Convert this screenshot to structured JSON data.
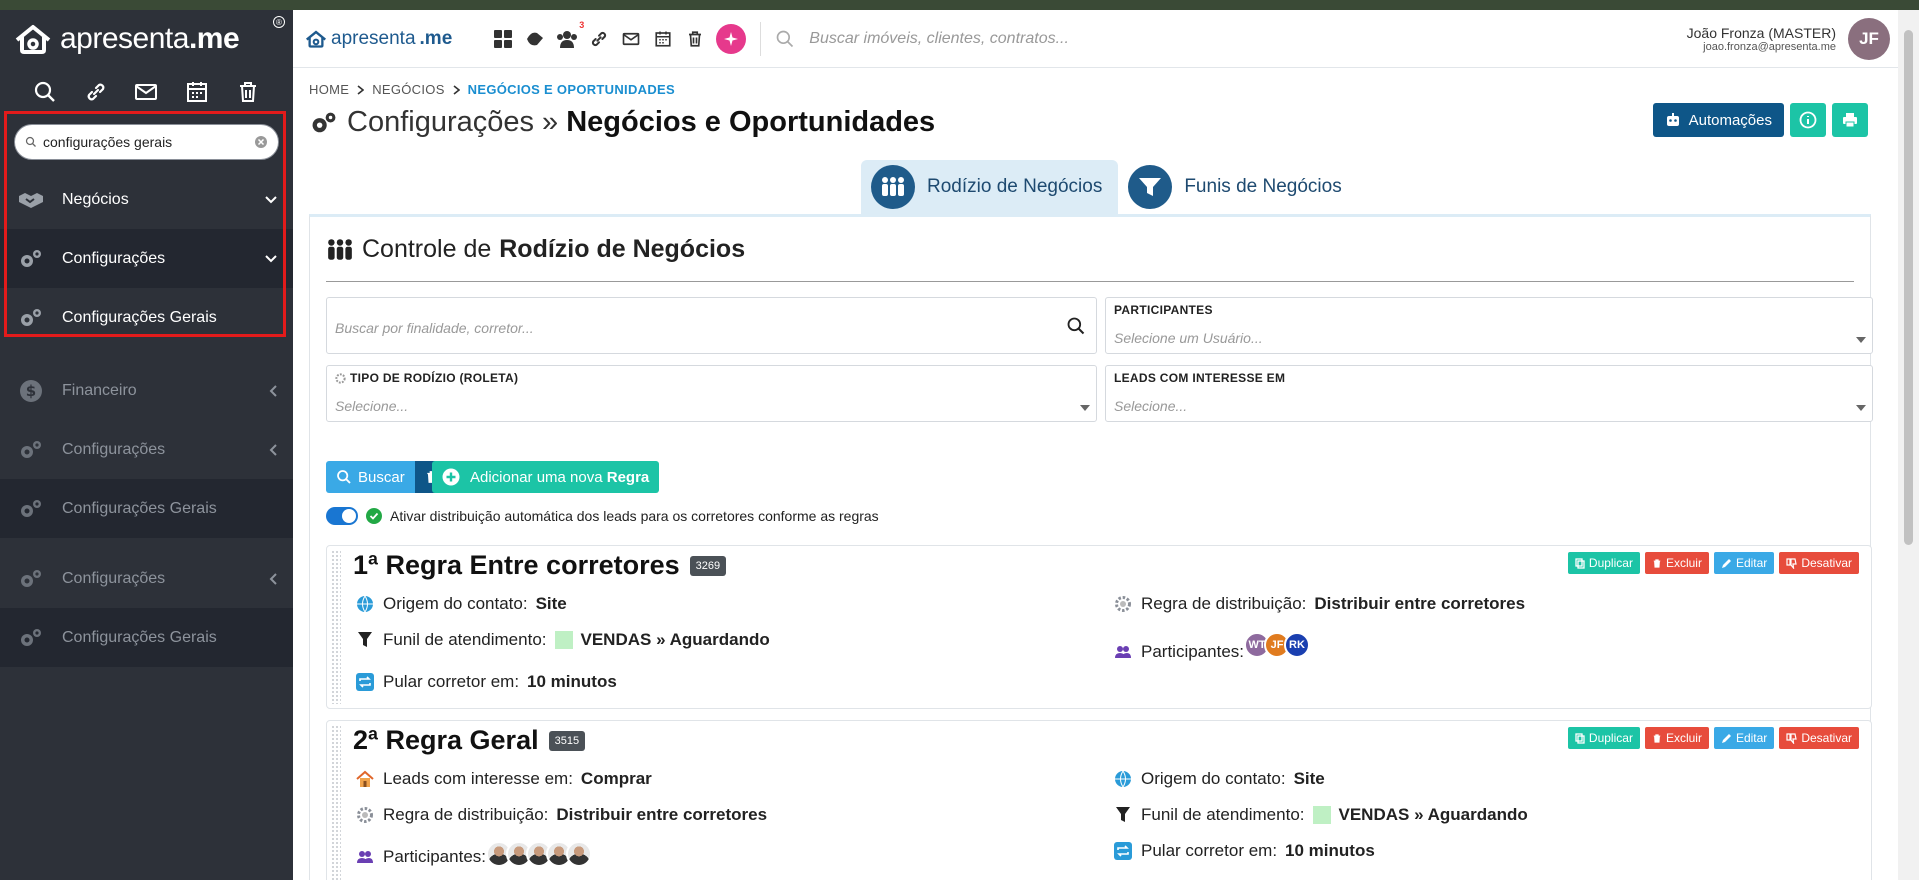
{
  "sidebar": {
    "brand_light": "apresenta",
    "brand_bold": ".me",
    "search_value": "configurações gerais",
    "items": [
      {
        "label": "Negócios",
        "icon": "handshake-icon"
      },
      {
        "label": "Configurações",
        "icon": "gears-icon"
      },
      {
        "label": "Configurações Gerais",
        "icon": "gears-icon"
      },
      {
        "label": "Financeiro",
        "icon": "dollar-icon"
      },
      {
        "label": "Configurações",
        "icon": "gears-icon"
      },
      {
        "label": "Configurações Gerais",
        "icon": "gears-icon"
      },
      {
        "label": "Configurações",
        "icon": "gears-icon"
      },
      {
        "label": "Configurações Gerais",
        "icon": "gears-icon"
      }
    ]
  },
  "header": {
    "brand_light": "apresenta",
    "brand_bold": ".me",
    "notification_count": "3",
    "search_placeholder": "Buscar imóveis, clientes, contratos...",
    "user_name": "João Fronza (MASTER)",
    "user_email": "joao.fronza@apresenta.me",
    "user_initials": "JF"
  },
  "breadcrumb": {
    "home": "HOME",
    "section": "NEGÓCIOS",
    "current": "NEGÓCIOS E OPORTUNIDADES"
  },
  "page": {
    "title_light": "Configurações »",
    "title_bold": "Negócios e Oportunidades",
    "automations_label": "Automações"
  },
  "tabs": [
    {
      "label": "Rodízio de Negócios"
    },
    {
      "label": "Funis de Negócios"
    }
  ],
  "panel": {
    "title_light": "Controle de",
    "title_bold": "Rodízio de Negócios",
    "search_placeholder": "Buscar por finalidade, corretor...",
    "participants_label": "PARTICIPANTES",
    "participants_placeholder": "Selecione um Usuário...",
    "type_label": "TIPO DE RODÍZIO (ROLETA)",
    "type_placeholder": "Selecione...",
    "leads_label": "LEADS COM INTERESSE EM",
    "leads_placeholder": "Selecione...",
    "search_button": "Buscar",
    "add_prefix": "Adicionar uma nova",
    "add_bold": "Regra",
    "auto_distribution": "Ativar distribuição automática dos leads para os corretores conforme as regras"
  },
  "actions": {
    "duplicate": "Duplicar",
    "delete": "Excluir",
    "edit": "Editar",
    "disable": "Desativar"
  },
  "rules": [
    {
      "title": "1ª Regra Entre corretores",
      "id": "3269",
      "origin_label": "Origem do contato:",
      "origin_value": "Site",
      "funnel_label": "Funil de atendimento:",
      "funnel_value": "VENDAS » Aguardando",
      "skip_label": "Pular corretor em:",
      "skip_value": "10 minutos",
      "distribution_label": "Regra de distribuição:",
      "distribution_value": "Distribuir entre corretores",
      "participants_label": "Participantes:",
      "participants": [
        {
          "initials": "WT",
          "color": "#8e6a9e"
        },
        {
          "initials": "JF",
          "color": "#e07b1f"
        },
        {
          "initials": "RK",
          "color": "#1a3fb0"
        }
      ]
    },
    {
      "title": "2ª Regra Geral",
      "id": "3515",
      "interest_label": "Leads com interesse em:",
      "interest_value": "Comprar",
      "distribution_label": "Regra de distribuição:",
      "distribution_value": "Distribuir entre corretores",
      "participants_label": "Participantes:",
      "origin_label": "Origem do contato:",
      "origin_value": "Site",
      "funnel_label": "Funil de atendimento:",
      "funnel_value": "VENDAS » Aguardando",
      "skip_label": "Pular corretor em:",
      "skip_value": "10 minutos"
    }
  ],
  "colors": {
    "sidebar_bg": "#2d3139",
    "accent_blue": "#0e5688",
    "accent_teal": "#1cc4a6",
    "link_blue": "#1a8ed0",
    "danger": "#e74c3c",
    "highlight_box": "#e31b1b"
  }
}
